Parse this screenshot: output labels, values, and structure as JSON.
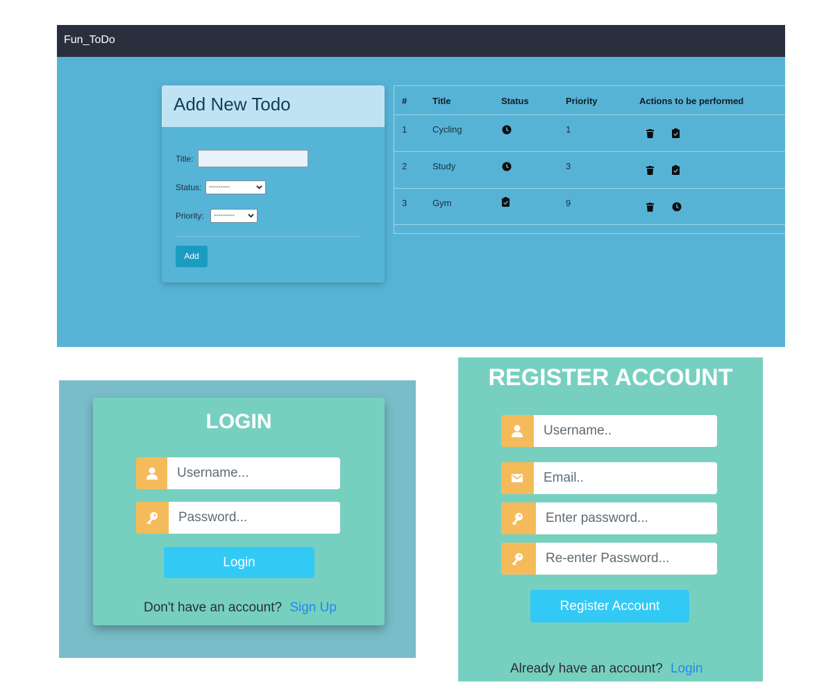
{
  "todo_app": {
    "brand": "Fun_ToDo",
    "form": {
      "title": "Add New Todo",
      "title_label": "Title:",
      "title_value": "",
      "status_label": "Status:",
      "status_value": "---------",
      "priority_label": "Priority:",
      "priority_value": "---------",
      "add_button": "Add"
    },
    "table": {
      "headers": [
        "#",
        "Title",
        "Status",
        "Priority",
        "Actions to be performed"
      ],
      "rows": [
        {
          "num": "1",
          "title": "Cycling",
          "status_icon": "clock-icon",
          "priority": "1",
          "actions": [
            "trash-icon",
            "clipboard-check-icon"
          ]
        },
        {
          "num": "2",
          "title": "Study",
          "status_icon": "clock-icon",
          "priority": "3",
          "actions": [
            "trash-icon",
            "clipboard-check-icon"
          ]
        },
        {
          "num": "3",
          "title": "Gym",
          "status_icon": "clipboard-check-icon",
          "priority": "9",
          "actions": [
            "trash-icon",
            "clock-icon"
          ]
        }
      ]
    },
    "colors": {
      "navbar": "#292f3d",
      "background": "#57b3d6",
      "card_header": "#c0e3f3",
      "add_button": "#1a9cc0"
    }
  },
  "login": {
    "title": "LOGIN",
    "username_placeholder": "Username...",
    "password_placeholder": "Password...",
    "button": "Login",
    "footer_text": "Don't have an account?",
    "footer_link": "Sign Up"
  },
  "register": {
    "title": "REGISTER ACCOUNT",
    "username_placeholder": "Username..",
    "email_placeholder": "Email..",
    "password_placeholder": "Enter password...",
    "confirm_placeholder": "Re-enter Password...",
    "button": "Register Account",
    "footer_text": "Already have an account?",
    "footer_link": "Login"
  },
  "theme": {
    "panel_teal": "#77d0bf",
    "addon_orange": "#f5bb5a",
    "button_blue": "#33c9f5",
    "link_blue": "#1f8ae8"
  }
}
